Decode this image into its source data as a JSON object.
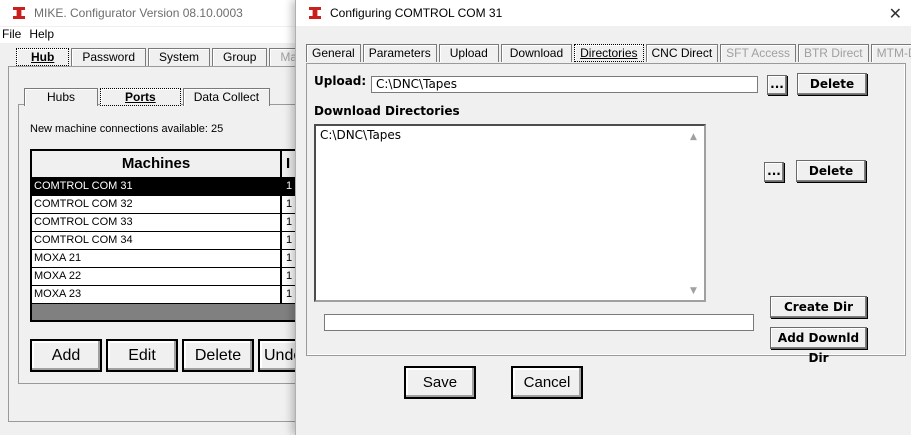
{
  "bg_window": {
    "title": "MIKE.  Configurator Version 08.10.0003",
    "menu": [
      "File",
      "Help"
    ],
    "top_tabs": [
      "Hub",
      "Password",
      "System",
      "Group",
      "Ma"
    ],
    "sub_tabs": [
      "Hubs",
      "Ports",
      "Data Collect"
    ],
    "available": "New machine connections available: 25",
    "grid": {
      "headers": [
        "Machines",
        "I"
      ],
      "rows": [
        {
          "name": "COMTROL COM 31",
          "val": "1"
        },
        {
          "name": "COMTROL COM 32",
          "val": "1"
        },
        {
          "name": "COMTROL COM 33",
          "val": "1"
        },
        {
          "name": "COMTROL COM 34",
          "val": "1"
        },
        {
          "name": "MOXA 21",
          "val": "1"
        },
        {
          "name": "MOXA 22",
          "val": "1"
        },
        {
          "name": "MOXA 23",
          "val": "1"
        }
      ]
    },
    "buttons": {
      "add": "Add",
      "edit": "Edit",
      "delete": "Delete",
      "undo": "Undo"
    }
  },
  "dialog": {
    "title": "Configuring COMTROL COM 31",
    "tabs": [
      "General",
      "Parameters",
      "Upload",
      "Download",
      "Directories",
      "CNC Direct",
      "SFT Access",
      "BTR Direct",
      "MTM-DNC"
    ],
    "upload_label": "Upload:",
    "upload_value": "C:\\DNC\\Tapes",
    "browse_label": "...",
    "delete_label": "Delete",
    "download_dirs_label": "Download Directories",
    "download_dirs": [
      "C:\\DNC\\Tapes"
    ],
    "new_dir_value": "",
    "create_dir_label": "Create Dir",
    "add_dir_label": "Add Downld Dir",
    "save_label": "Save",
    "cancel_label": "Cancel"
  },
  "colors": {
    "brand_icon": "#c9201d",
    "selection": "#000000",
    "window_bg": "#f0f0f0"
  }
}
